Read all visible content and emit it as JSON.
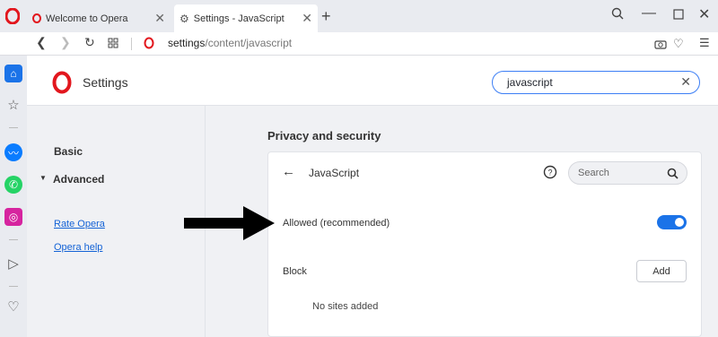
{
  "tabs": [
    {
      "title": "Welcome to Opera",
      "icon": "opera-logo-icon",
      "active": false
    },
    {
      "title": "Settings - JavaScript",
      "icon": "gear-icon",
      "active": true
    }
  ],
  "window_controls": [
    "search-tabs-icon",
    "minimize-icon",
    "maximize-icon",
    "close-icon"
  ],
  "address": {
    "url_host": "settings",
    "url_path": "/content/javascript"
  },
  "settings": {
    "title": "Settings",
    "search_value": "javascript"
  },
  "leftmenu": {
    "basic": "Basic",
    "advanced": "Advanced",
    "rate": "Rate Opera",
    "help": "Opera help"
  },
  "content": {
    "section_title": "Privacy and security",
    "page_title": "JavaScript",
    "page_search_placeholder": "Search",
    "allowed_label": "Allowed (recommended)",
    "allowed_enabled": true,
    "block_label": "Block",
    "add_label": "Add",
    "no_sites": "No sites added"
  },
  "colors": {
    "accent": "#1b73e8",
    "opera_red": "#e2161d",
    "link": "#1463d6"
  }
}
